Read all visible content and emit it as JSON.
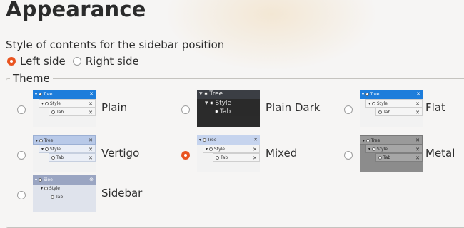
{
  "page": {
    "title": "Appearance"
  },
  "sidebar_position": {
    "label": "Style of contents for the sidebar position",
    "options": [
      {
        "label": "Left side",
        "selected": true
      },
      {
        "label": "Right side",
        "selected": false
      }
    ]
  },
  "theme": {
    "legend": "Theme",
    "preview": {
      "tree": "Tree",
      "style": "Style",
      "tab": "Tab",
      "close": "✕"
    },
    "sidebar_preview_tree": "Siee",
    "options": [
      {
        "label": "Plain",
        "selected": false
      },
      {
        "label": "Plain Dark",
        "selected": false
      },
      {
        "label": "Flat",
        "selected": false
      },
      {
        "label": "Vertigo",
        "selected": false
      },
      {
        "label": "Mixed",
        "selected": true
      },
      {
        "label": "Metal",
        "selected": false
      },
      {
        "label": "Sidebar",
        "selected": false
      }
    ]
  },
  "colors": {
    "accent": "#e95420",
    "selected_tab_blue": "#1d7ddb"
  }
}
